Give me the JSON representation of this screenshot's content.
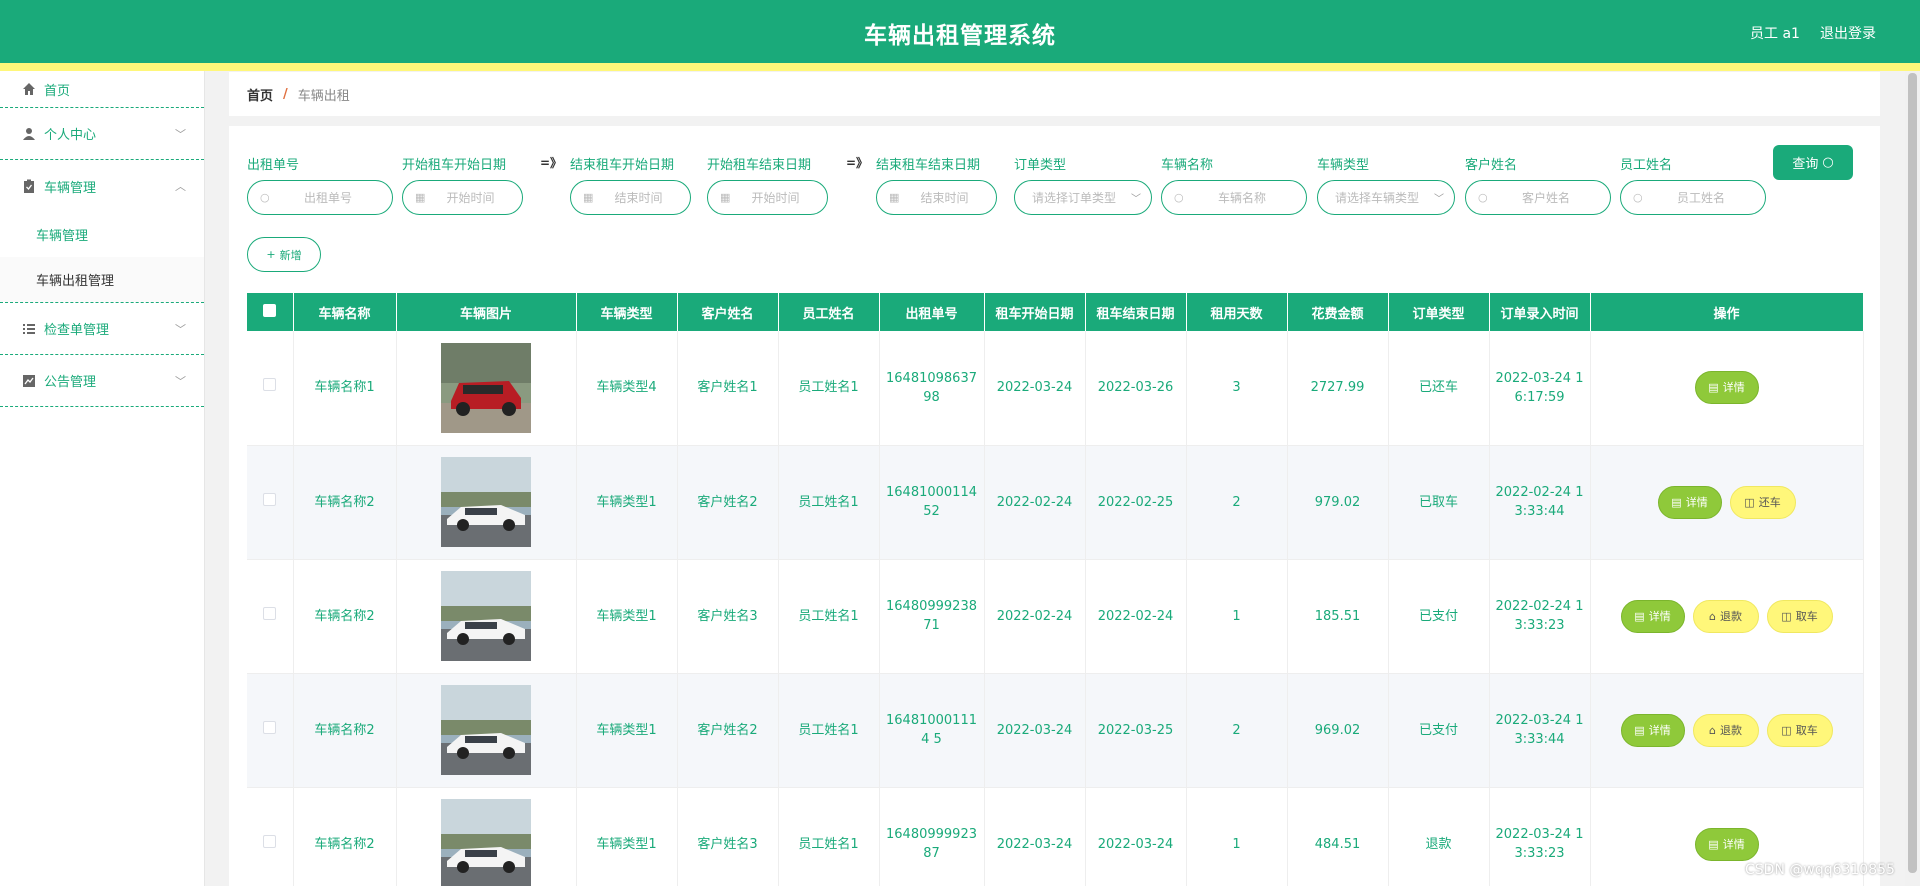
{
  "header": {
    "title": "车辆出租管理系统",
    "user": "员工 a1",
    "logout": "退出登录"
  },
  "sidebar": {
    "items": [
      {
        "label": "首页"
      },
      {
        "label": "个人中心"
      },
      {
        "label": "车辆管理",
        "children": [
          "车辆管理",
          "车辆出租管理"
        ]
      },
      {
        "label": "检查单管理"
      },
      {
        "label": "公告管理"
      }
    ]
  },
  "breadcrumb": {
    "home": "首页",
    "sep": "/",
    "current": "车辆出租"
  },
  "filters": {
    "order_no": {
      "label": "出租单号",
      "placeholder": "出租单号"
    },
    "start_from": {
      "label": "开始租车开始日期",
      "placeholder": "开始时间"
    },
    "start_to": {
      "label": "结束租车开始日期",
      "placeholder": "结束时间"
    },
    "end_from": {
      "label": "开始租车结束日期",
      "placeholder": "开始时间"
    },
    "end_to": {
      "label": "结束租车结束日期",
      "placeholder": "结束时间"
    },
    "order_type": {
      "label": "订单类型",
      "placeholder": "请选择订单类型"
    },
    "car_name": {
      "label": "车辆名称",
      "placeholder": "车辆名称"
    },
    "car_type": {
      "label": "车辆类型",
      "placeholder": "请选择车辆类型"
    },
    "customer": {
      "label": "客户姓名",
      "placeholder": "客户姓名"
    },
    "staff": {
      "label": "员工姓名",
      "placeholder": "员工姓名"
    },
    "range_sep": "=》",
    "query": "查询",
    "add": "新增"
  },
  "table": {
    "headers": [
      "车辆名称",
      "车辆图片",
      "车辆类型",
      "客户姓名",
      "员工姓名",
      "出租单号",
      "租车开始日期",
      "租车结束日期",
      "租用天数",
      "花费金额",
      "订单类型",
      "订单录入时间",
      "操作"
    ],
    "rows": [
      {
        "car_name": "车辆名称1",
        "image": "red-suv",
        "car_type": "车辆类型4",
        "customer": "客户姓名1",
        "staff": "员工姓名1",
        "order_no": "1648109863798",
        "start": "2022-03-24",
        "end": "2022-03-26",
        "days": "3",
        "amount": "2727.99",
        "status": "已还车",
        "created": "2022-03-24 16:17:59",
        "actions": [
          "详情"
        ]
      },
      {
        "car_name": "车辆名称2",
        "image": "white-sedan",
        "car_type": "车辆类型1",
        "customer": "客户姓名2",
        "staff": "员工姓名1",
        "order_no": "1648100011452",
        "start": "2022-02-24",
        "end": "2022-02-25",
        "days": "2",
        "amount": "979.02",
        "status": "已取车",
        "created": "2022-02-24 13:33:44",
        "actions": [
          "详情",
          "还车"
        ]
      },
      {
        "car_name": "车辆名称2",
        "image": "white-sedan",
        "car_type": "车辆类型1",
        "customer": "客户姓名3",
        "staff": "员工姓名1",
        "order_no": "1648099923871",
        "start": "2022-02-24",
        "end": "2022-02-24",
        "days": "1",
        "amount": "185.51",
        "status": "已支付",
        "created": "2022-02-24 13:33:23",
        "actions": [
          "详情",
          "退款",
          "取车"
        ]
      },
      {
        "car_name": "车辆名称2",
        "image": "white-sedan",
        "car_type": "车辆类型1",
        "customer": "客户姓名2",
        "staff": "员工姓名1",
        "order_no": "164810001114 5",
        "start": "2022-03-24",
        "end": "2022-03-25",
        "days": "2",
        "amount": "969.02",
        "status": "已支付",
        "created": "2022-03-24 13:33:44",
        "actions": [
          "详情",
          "退款",
          "取车"
        ]
      },
      {
        "car_name": "车辆名称2",
        "image": "white-sedan",
        "car_type": "车辆类型1",
        "customer": "客户姓名3",
        "staff": "员工姓名1",
        "order_no": "1648099992387",
        "start": "2022-03-24",
        "end": "2022-03-24",
        "days": "1",
        "amount": "484.51",
        "status": "退款",
        "created": "2022-03-24 13:33:23",
        "actions": [
          "详情"
        ]
      }
    ]
  },
  "watermark": "CSDN @wqq6310855",
  "colors": {
    "primary": "#1aaa7a",
    "accent_yellow": "#fff77a",
    "detail_green": "#8fc93a"
  }
}
